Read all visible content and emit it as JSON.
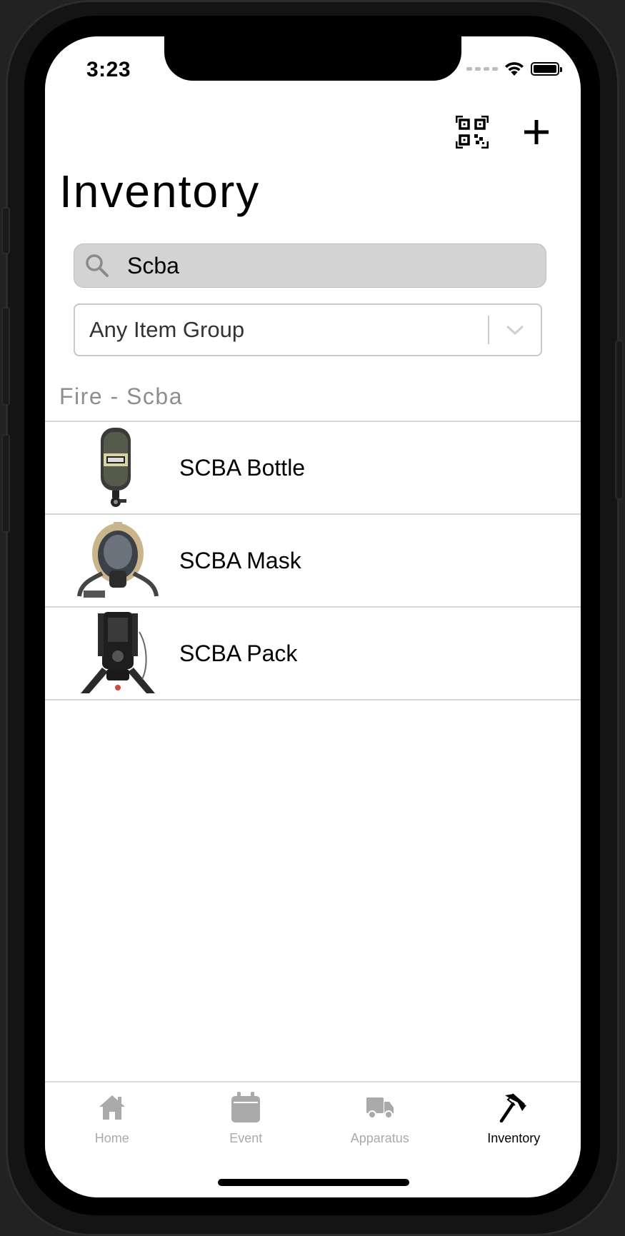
{
  "status_bar": {
    "time": "3:23"
  },
  "header": {
    "title": "Inventory",
    "scan_icon": "qr-code-icon",
    "add_icon": "plus-icon"
  },
  "search": {
    "value": "Scba",
    "icon": "search-icon"
  },
  "filter": {
    "selected": "Any Item Group",
    "icon": "chevron-down-icon"
  },
  "section": {
    "title": "Fire - Scba",
    "items": [
      {
        "label": "SCBA Bottle",
        "thumb": "scba-bottle-image"
      },
      {
        "label": "SCBA Mask",
        "thumb": "scba-mask-image"
      },
      {
        "label": "SCBA Pack",
        "thumb": "scba-pack-image"
      }
    ]
  },
  "tabbar": {
    "tabs": [
      {
        "label": "Home",
        "icon": "home-icon",
        "active": false
      },
      {
        "label": "Event",
        "icon": "calendar-icon",
        "active": false
      },
      {
        "label": "Apparatus",
        "icon": "truck-icon",
        "active": false
      },
      {
        "label": "Inventory",
        "icon": "axe-icon",
        "active": true
      }
    ]
  },
  "colors": {
    "inactive_tab": "#aaaaaa",
    "active_tab": "#000000",
    "section_header": "#8e8e8e",
    "search_bg": "#d3d3d3"
  }
}
